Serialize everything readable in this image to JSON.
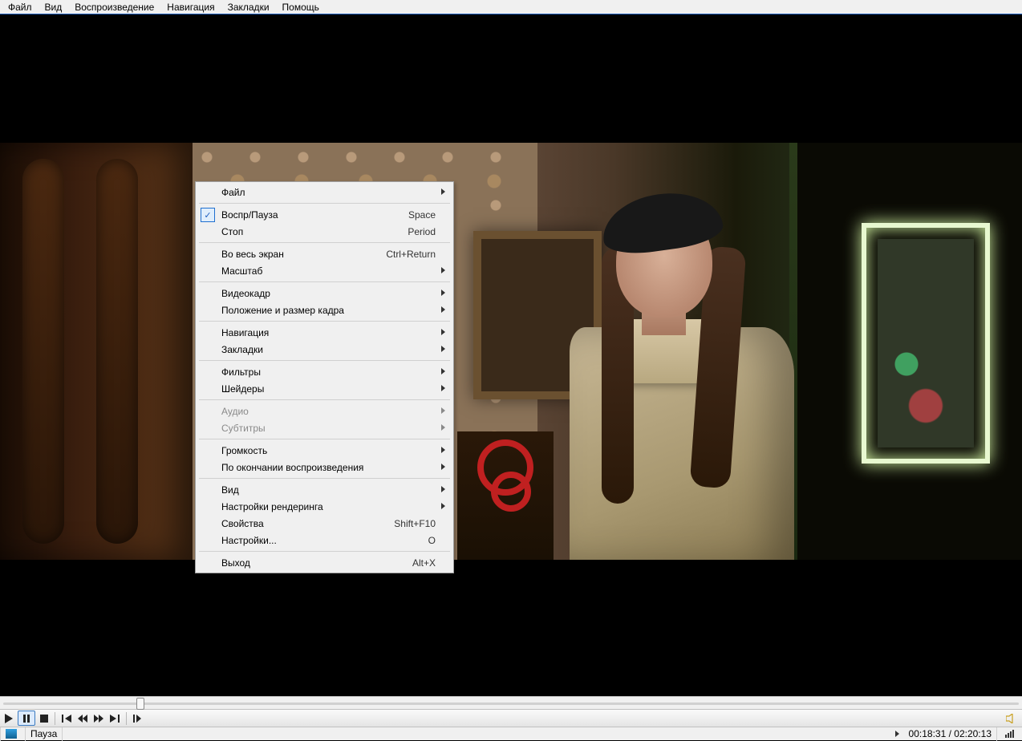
{
  "menubar": [
    "Файл",
    "Вид",
    "Воспроизведение",
    "Навигация",
    "Закладки",
    "Помощь"
  ],
  "context_menu": [
    {
      "type": "item",
      "label": "Файл",
      "submenu": true
    },
    {
      "type": "sep"
    },
    {
      "type": "item",
      "label": "Воспр/Пауза",
      "shortcut": "Space",
      "checked": true
    },
    {
      "type": "item",
      "label": "Стоп",
      "shortcut": "Period"
    },
    {
      "type": "sep"
    },
    {
      "type": "item",
      "label": "Во весь экран",
      "shortcut": "Ctrl+Return"
    },
    {
      "type": "item",
      "label": "Масштаб",
      "submenu": true
    },
    {
      "type": "sep"
    },
    {
      "type": "item",
      "label": "Видеокадр",
      "submenu": true
    },
    {
      "type": "item",
      "label": "Положение и размер кадра",
      "submenu": true
    },
    {
      "type": "sep"
    },
    {
      "type": "item",
      "label": "Навигация",
      "submenu": true
    },
    {
      "type": "item",
      "label": "Закладки",
      "submenu": true
    },
    {
      "type": "sep"
    },
    {
      "type": "item",
      "label": "Фильтры",
      "submenu": true
    },
    {
      "type": "item",
      "label": "Шейдеры",
      "submenu": true
    },
    {
      "type": "sep"
    },
    {
      "type": "item",
      "label": "Аудио",
      "submenu": true,
      "disabled": true
    },
    {
      "type": "item",
      "label": "Субтитры",
      "submenu": true,
      "disabled": true
    },
    {
      "type": "sep"
    },
    {
      "type": "item",
      "label": "Громкость",
      "submenu": true
    },
    {
      "type": "item",
      "label": "По окончании воспроизведения",
      "submenu": true
    },
    {
      "type": "sep"
    },
    {
      "type": "item",
      "label": "Вид",
      "submenu": true
    },
    {
      "type": "item",
      "label": "Настройки рендеринга",
      "submenu": true
    },
    {
      "type": "item",
      "label": "Свойства",
      "shortcut": "Shift+F10"
    },
    {
      "type": "item",
      "label": "Настройки...",
      "shortcut": "O"
    },
    {
      "type": "sep"
    },
    {
      "type": "item",
      "label": "Выход",
      "shortcut": "Alt+X"
    }
  ],
  "playback": {
    "elapsed": "00:18:31",
    "total": "02:20:13",
    "progress_pct": 13.2
  },
  "status": {
    "state": "Пауза"
  }
}
